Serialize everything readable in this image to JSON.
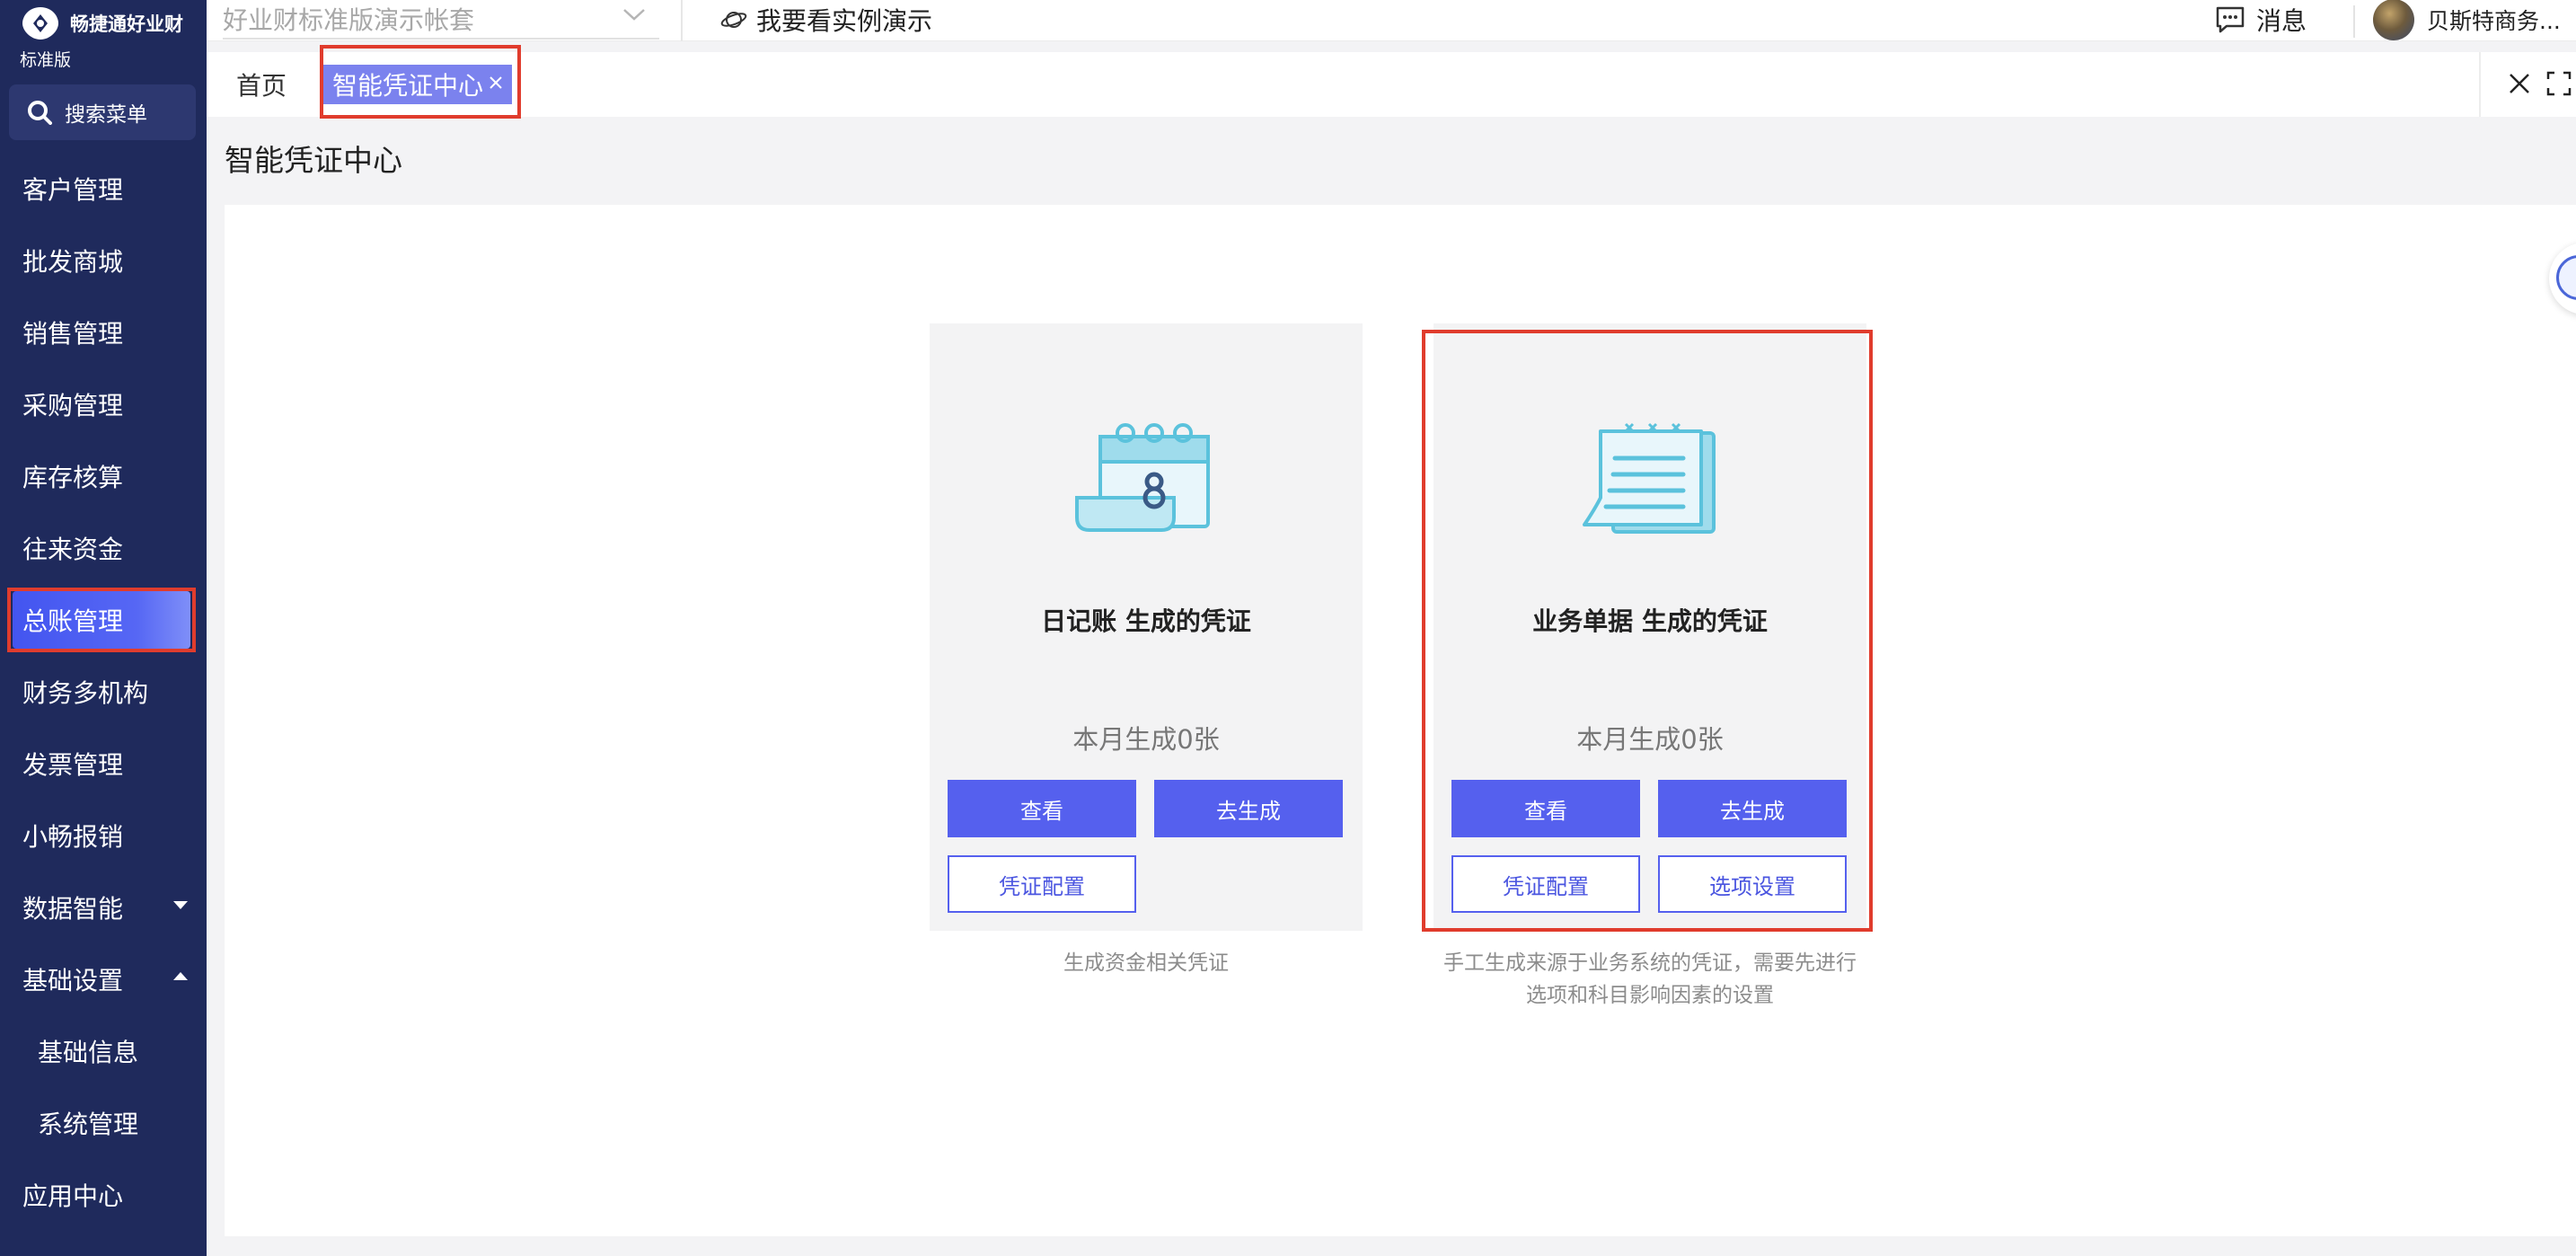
{
  "brand": {
    "name": "畅捷通好业财",
    "edition": "标准版"
  },
  "sidebar": {
    "search_label": "搜索菜单",
    "items": [
      {
        "label": "客户管理"
      },
      {
        "label": "批发商城"
      },
      {
        "label": "销售管理"
      },
      {
        "label": "采购管理"
      },
      {
        "label": "库存核算"
      },
      {
        "label": "往来资金"
      },
      {
        "label": "总账管理",
        "active": true
      },
      {
        "label": "财务多机构"
      },
      {
        "label": "发票管理"
      },
      {
        "label": "小畅报销"
      },
      {
        "label": "数据智能",
        "caret": "down"
      },
      {
        "label": "基础设置",
        "caret": "up"
      },
      {
        "label": "基础信息",
        "sub": true
      },
      {
        "label": "系统管理",
        "sub": true
      },
      {
        "label": "应用中心"
      }
    ]
  },
  "topbar": {
    "account_placeholder": "好业财标准版演示帐套",
    "demo_label": "我要看实例演示",
    "messages_label": "消息",
    "user_name": "贝斯特商务..."
  },
  "tabs": {
    "home_label": "首页",
    "active_label": "智能凭证中心",
    "close_symbol": "×"
  },
  "page": {
    "title": "智能凭证中心"
  },
  "cards": [
    {
      "title": "日记账 生成的凭证",
      "count_text": "本月生成0张",
      "view_label": "查看",
      "generate_label": "去生成",
      "config_label": "凭证配置",
      "description": "生成资金相关凭证",
      "icon": "calendar-icon"
    },
    {
      "title": "业务单据 生成的凭证",
      "count_text": "本月生成0张",
      "view_label": "查看",
      "generate_label": "去生成",
      "config_label": "凭证配置",
      "options_label": "选项设置",
      "description_line1": "手工生成来源于业务系统的凭证，需要先进行",
      "description_line2": "选项和科目影响因素的设置",
      "icon": "document-icon"
    }
  ],
  "colors": {
    "sidebar_bg": "#1f2a5c",
    "primary": "#5560ee",
    "highlight": "#e03c2d",
    "tab_active": "#7b82ee"
  }
}
